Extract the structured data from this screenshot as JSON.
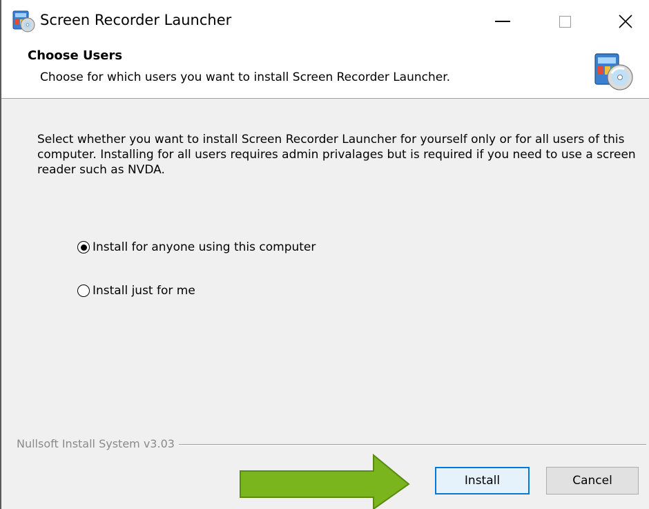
{
  "window": {
    "title": "Screen Recorder Launcher",
    "controls": [
      "minimize",
      "maximize",
      "close"
    ]
  },
  "header": {
    "title": "Choose Users",
    "subtitle": "Choose for which users you want to install Screen Recorder Launcher.",
    "icon": "installer-cd-icon"
  },
  "body": {
    "description": "Select whether you want to install Screen Recorder Launcher for yourself only or for all users of this computer.  Installing for all users requires admin privalages but is required if you need to use a screen reader such as NVDA.",
    "options": [
      {
        "label": "Install for anyone using this computer",
        "selected": true
      },
      {
        "label": "Install just for me",
        "selected": false
      }
    ]
  },
  "footer": {
    "branding": "Nullsoft Install System v3.03",
    "install_label": "Install",
    "cancel_label": "Cancel"
  },
  "annotation": {
    "arrow_color": "#7ab51d",
    "arrow_border": "#5a8a10"
  },
  "colors": {
    "focus_border": "#0078d7",
    "dialog_bg": "#f0f0f0"
  }
}
